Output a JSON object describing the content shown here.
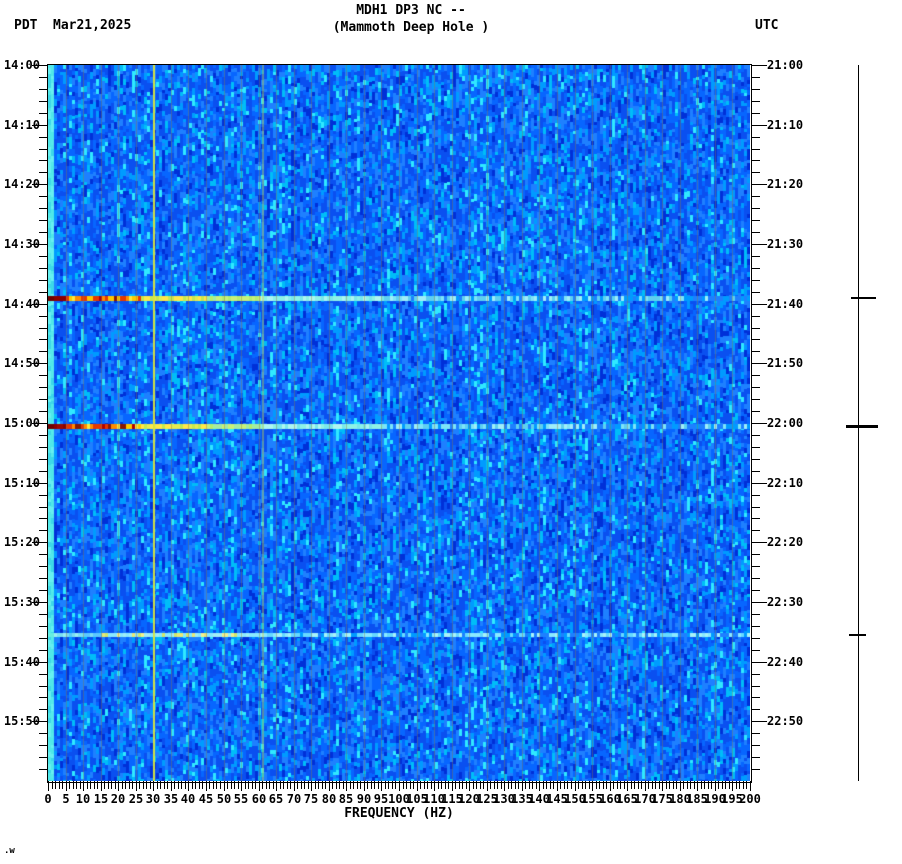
{
  "header": {
    "tz_left": "PDT",
    "date": "Mar21,2025",
    "title_line1": "MDH1 DP3 NC --",
    "title_line2": "(Mammoth Deep Hole )",
    "tz_right": "UTC"
  },
  "footer": {
    "watermark": ".w"
  },
  "chart_data": {
    "type": "heatmap",
    "title": "MDH1 DP3 NC -- (Mammoth Deep Hole )",
    "xlabel": "FREQUENCY (HZ)",
    "x_range_hz": [
      0,
      200
    ],
    "x_major_tick_step_hz": 5,
    "x_minor_tick_step_hz": 1,
    "x_tick_labels": [
      "0",
      "5",
      "10",
      "15",
      "20",
      "25",
      "30",
      "35",
      "40",
      "45",
      "50",
      "55",
      "60",
      "65",
      "70",
      "75",
      "80",
      "85",
      "90",
      "95",
      "100",
      "105",
      "110",
      "115",
      "120",
      "125",
      "130",
      "135",
      "140",
      "145",
      "150",
      "155",
      "160",
      "165",
      "170",
      "175",
      "180",
      "185",
      "190",
      "195",
      "200"
    ],
    "time_start_pdt": "14:00",
    "time_end_pdt": "16:00",
    "time_start_utc": "21:00",
    "time_end_utc": "23:00",
    "major_tick_interval_min": 10,
    "minor_tick_interval_min": 2,
    "left_axis_ticks_pdt": [
      "14:00",
      "14:10",
      "14:20",
      "14:30",
      "14:40",
      "14:50",
      "15:00",
      "15:10",
      "15:20",
      "15:30",
      "15:40",
      "15:50"
    ],
    "right_axis_ticks_utc": [
      "21:00",
      "21:10",
      "21:20",
      "21:30",
      "21:40",
      "21:50",
      "22:00",
      "22:10",
      "22:20",
      "22:30",
      "22:40",
      "22:50"
    ],
    "grid": "faint olive vertical gridlines every 5 Hz",
    "vertical_lines_hz": [
      {
        "hz": 30,
        "color": "#dce83c",
        "appearance": "bright yellow-green persistent line"
      },
      {
        "hz": 61,
        "color": "#b8cc50",
        "appearance": "faint olive-green persistent line"
      }
    ],
    "events": [
      {
        "time_pdt": "14:39",
        "time_utc": "21:39",
        "minutes_from_start": 39,
        "strength": "strong",
        "description": "broadband event: dark red 0-5 Hz, red/orange/yellow barcode to ~25 Hz, yellow-green to ~45 Hz, pale cyan tail to 200 Hz"
      },
      {
        "time_pdt": "15:00",
        "time_utc": "22:00",
        "minutes_from_start": 60.5,
        "strength": "strong",
        "description": "broadband event: dark red 0-5 Hz, red/orange/yellow barcode to ~25 Hz, yellow-green to ~45 Hz, pale cyan tail to 200 Hz"
      },
      {
        "time_pdt": "15:35",
        "time_utc": "22:35",
        "minutes_from_start": 95.5,
        "strength": "weak",
        "description": "faint broadband band: pale cyan with yellow speckles 15-60 Hz"
      }
    ],
    "palette": {
      "background_blues": [
        "#0030d8",
        "#0a50f0",
        "#0766ff",
        "#1e80ff",
        "#009bff",
        "#00bdf8",
        "#30e8ff"
      ],
      "low_freq_edge_cyan": "#55eaea",
      "event_hot": [
        "#b30000",
        "#e63900",
        "#ff8c00",
        "#ffc800",
        "#ffe83c",
        "#8a1a00"
      ],
      "event_warm": [
        "#ffe84a",
        "#e4ec52",
        "#c6e850"
      ],
      "event_tail_cyan": [
        "#7ee4f8",
        "#a0eef8",
        "#5fd0f0"
      ],
      "gridline_olive": "#8a7d4a"
    }
  },
  "right_marker_line": {
    "description": "vertical reference line right of plot with ticks at event times",
    "ticks": [
      {
        "time_utc": "21:39",
        "minutes_from_start": 39,
        "size": "medium"
      },
      {
        "time_utc": "22:00",
        "minutes_from_start": 60.5,
        "size": "large"
      },
      {
        "time_utc": "22:35",
        "minutes_from_start": 95.5,
        "size": "small"
      }
    ]
  }
}
